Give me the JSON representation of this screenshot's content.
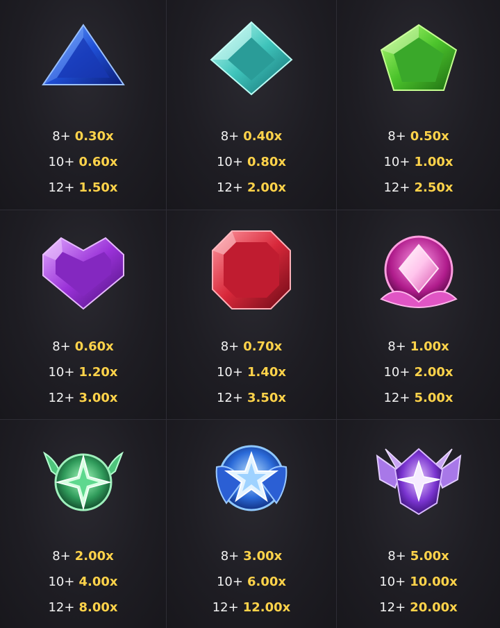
{
  "paytable": [
    {
      "symbol": "blue-triangle-gem-icon",
      "pays": [
        {
          "count": "8+",
          "mult": "0.30x"
        },
        {
          "count": "10+",
          "mult": "0.60x"
        },
        {
          "count": "12+",
          "mult": "1.50x"
        }
      ]
    },
    {
      "symbol": "teal-diamond-gem-icon",
      "pays": [
        {
          "count": "8+",
          "mult": "0.40x"
        },
        {
          "count": "10+",
          "mult": "0.80x"
        },
        {
          "count": "12+",
          "mult": "2.00x"
        }
      ]
    },
    {
      "symbol": "green-pentagon-gem-icon",
      "pays": [
        {
          "count": "8+",
          "mult": "0.50x"
        },
        {
          "count": "10+",
          "mult": "1.00x"
        },
        {
          "count": "12+",
          "mult": "2.50x"
        }
      ]
    },
    {
      "symbol": "purple-heart-gem-icon",
      "pays": [
        {
          "count": "8+",
          "mult": "0.60x"
        },
        {
          "count": "10+",
          "mult": "1.20x"
        },
        {
          "count": "12+",
          "mult": "3.00x"
        }
      ]
    },
    {
      "symbol": "red-octagon-gem-icon",
      "pays": [
        {
          "count": "8+",
          "mult": "0.70x"
        },
        {
          "count": "10+",
          "mult": "1.40x"
        },
        {
          "count": "12+",
          "mult": "3.50x"
        }
      ]
    },
    {
      "symbol": "pink-lotus-gem-icon",
      "pays": [
        {
          "count": "8+",
          "mult": "1.00x"
        },
        {
          "count": "10+",
          "mult": "2.00x"
        },
        {
          "count": "12+",
          "mult": "5.00x"
        }
      ]
    },
    {
      "symbol": "green-star-emblem-icon",
      "pays": [
        {
          "count": "8+",
          "mult": "2.00x"
        },
        {
          "count": "10+",
          "mult": "4.00x"
        },
        {
          "count": "12+",
          "mult": "8.00x"
        }
      ]
    },
    {
      "symbol": "blue-star-bow-emblem-icon",
      "pays": [
        {
          "count": "8+",
          "mult": "3.00x"
        },
        {
          "count": "10+",
          "mult": "6.00x"
        },
        {
          "count": "12+",
          "mult": "12.00x"
        }
      ]
    },
    {
      "symbol": "violet-winged-star-emblem-icon",
      "pays": [
        {
          "count": "8+",
          "mult": "5.00x"
        },
        {
          "count": "10+",
          "mult": "10.00x"
        },
        {
          "count": "12+",
          "mult": "20.00x"
        }
      ]
    }
  ],
  "colors": {
    "background": "#1b1a20",
    "count_text": "#f2f2f2",
    "multiplier_text": "#ffd34a",
    "divider": "#2e2d35"
  }
}
